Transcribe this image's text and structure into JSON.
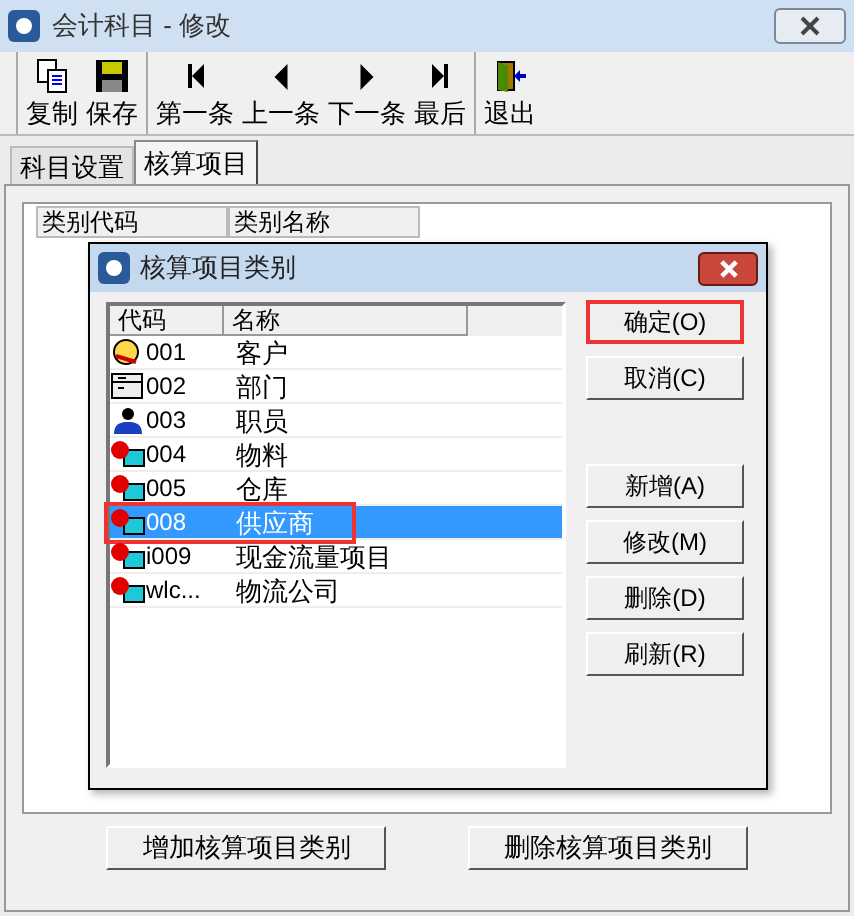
{
  "window": {
    "title": "会计科目 - 修改"
  },
  "toolbar": [
    [
      {
        "label": "复制",
        "kind": "copy"
      },
      {
        "label": "保存",
        "kind": "save"
      }
    ],
    [
      {
        "label": "第一条",
        "kind": "first"
      },
      {
        "label": "上一条",
        "kind": "prev"
      },
      {
        "label": "下一条",
        "kind": "next"
      },
      {
        "label": "最后",
        "kind": "last"
      }
    ],
    [
      {
        "label": "退出",
        "kind": "exit"
      }
    ]
  ],
  "tabs": [
    {
      "label": "科目设置",
      "selected": false
    },
    {
      "label": "核算项目",
      "selected": true
    }
  ],
  "grid": {
    "columns": [
      "类别代码",
      "类别名称"
    ]
  },
  "dialog": {
    "title": "核算项目类别",
    "columns": [
      "代码",
      "名称"
    ],
    "rows": [
      {
        "code": "001",
        "name": "客户",
        "kind": "customer",
        "selected": false,
        "highlighted": false
      },
      {
        "code": "002",
        "name": "部门",
        "kind": "department",
        "selected": false,
        "highlighted": false
      },
      {
        "code": "003",
        "name": "职员",
        "kind": "staff",
        "selected": false,
        "highlighted": false
      },
      {
        "code": "004",
        "name": "物料",
        "kind": "item",
        "selected": false,
        "highlighted": false
      },
      {
        "code": "005",
        "name": "仓库",
        "kind": "item",
        "selected": false,
        "highlighted": false
      },
      {
        "code": "008",
        "name": "供应商",
        "kind": "item",
        "selected": true,
        "highlighted": true
      },
      {
        "code": "i009",
        "name": "现金流量项目",
        "kind": "item",
        "selected": false,
        "highlighted": false
      },
      {
        "code": "wlc...",
        "name": "物流公司",
        "kind": "item",
        "selected": false,
        "highlighted": false
      }
    ],
    "buttons": [
      {
        "label": "确定(O)",
        "highlighted": true
      },
      {
        "label": "取消(C)",
        "highlighted": false
      },
      {
        "label": "新增(A)",
        "highlighted": false
      },
      {
        "label": "修改(M)",
        "highlighted": false
      },
      {
        "label": "删除(D)",
        "highlighted": false
      },
      {
        "label": "刷新(R)",
        "highlighted": false
      }
    ]
  },
  "bottom_buttons": [
    "增加核算项目类别",
    "删除核算项目类别"
  ]
}
